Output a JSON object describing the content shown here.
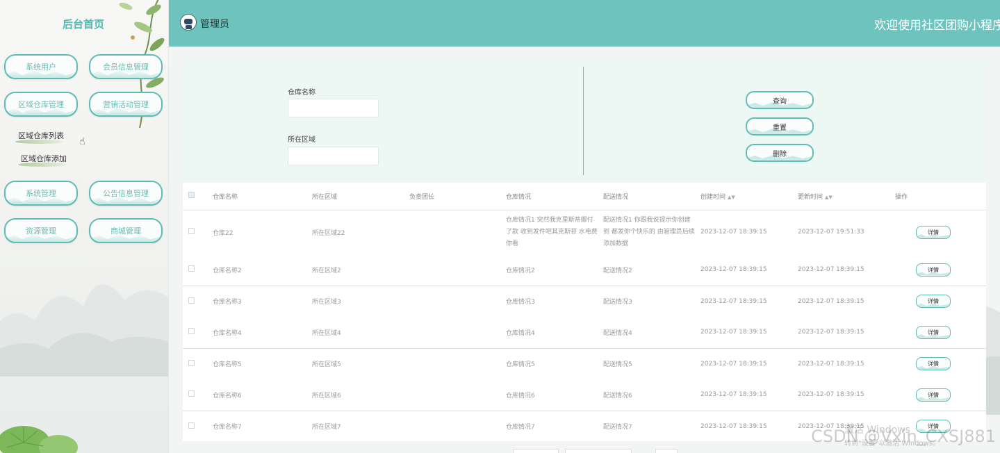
{
  "sidebar": {
    "brand": "后台首页",
    "menu": [
      {
        "label": "系统用户"
      },
      {
        "label": "会员信息管理"
      },
      {
        "label": "区域仓库管理"
      },
      {
        "label": "营销活动管理"
      },
      {
        "label": "系统管理"
      },
      {
        "label": "公告信息管理"
      },
      {
        "label": "资源管理"
      },
      {
        "label": "商城管理"
      }
    ],
    "submenu": [
      {
        "label": "区域仓库列表"
      },
      {
        "label": "区域仓库添加"
      }
    ]
  },
  "header": {
    "admin_name": "管理员",
    "welcome": "欢迎使用社区团购小程序"
  },
  "search": {
    "warehouse_label": "仓库名称",
    "region_label": "所在区域",
    "query_label": "查询",
    "reset_label": "重置",
    "delete_label": "删除"
  },
  "table": {
    "columns": [
      "仓库名称",
      "所在区域",
      "负责团长",
      "仓库情况",
      "配送情况",
      "创建时间",
      "更新时间",
      "操作"
    ],
    "detail_label": "详情",
    "rows": [
      {
        "name": "仓库22",
        "region": "所在区域22",
        "leader": "",
        "status": "仓库情况1 突然我克里斯蒂娜付了款 收到发件吧其克斯顿 水电费你看",
        "delivery": "配送情况1 你跟我说提示你创建到 都发你个快乐的 由管理员后续添加数据",
        "created": "2023-12-07 18:39:15",
        "updated": "2023-12-07 19:51:33"
      },
      {
        "name": "仓库名称2",
        "region": "所在区域2",
        "leader": "",
        "status": "仓库情况2",
        "delivery": "配送情况2",
        "created": "2023-12-07 18:39:15",
        "updated": "2023-12-07 18:39:15"
      },
      {
        "name": "仓库名称3",
        "region": "所在区域3",
        "leader": "",
        "status": "仓库情况3",
        "delivery": "配送情况3",
        "created": "2023-12-07 18:39:15",
        "updated": "2023-12-07 18:39:15"
      },
      {
        "name": "仓库名称4",
        "region": "所在区域4",
        "leader": "",
        "status": "仓库情况4",
        "delivery": "配送情况4",
        "created": "2023-12-07 18:39:15",
        "updated": "2023-12-07 18:39:15"
      },
      {
        "name": "仓库名称5",
        "region": "所在区域5",
        "leader": "",
        "status": "仓库情况5",
        "delivery": "配送情况5",
        "created": "2023-12-07 18:39:15",
        "updated": "2023-12-07 18:39:15"
      },
      {
        "name": "仓库名称6",
        "region": "所在区域6",
        "leader": "",
        "status": "仓库情况6",
        "delivery": "配送情况6",
        "created": "2023-12-07 18:39:15",
        "updated": "2023-12-07 18:39:15"
      },
      {
        "name": "仓库名称7",
        "region": "所在区域7",
        "leader": "",
        "status": "仓库情况7",
        "delivery": "配送情况7",
        "created": "2023-12-07 18:39:15",
        "updated": "2023-12-07 18:39:15"
      }
    ]
  },
  "watermark": {
    "text": "CSDN @Vxin_CXSJ881",
    "windows_line1": "激活 Windows",
    "windows_line2": "转到\"设置\"以激活 Windows。"
  },
  "colors": {
    "accent": "#6ec3be",
    "button_border": "#5dbdb5",
    "brand_text": "#4fb7b0",
    "panel_bg": "#edf7f3"
  }
}
